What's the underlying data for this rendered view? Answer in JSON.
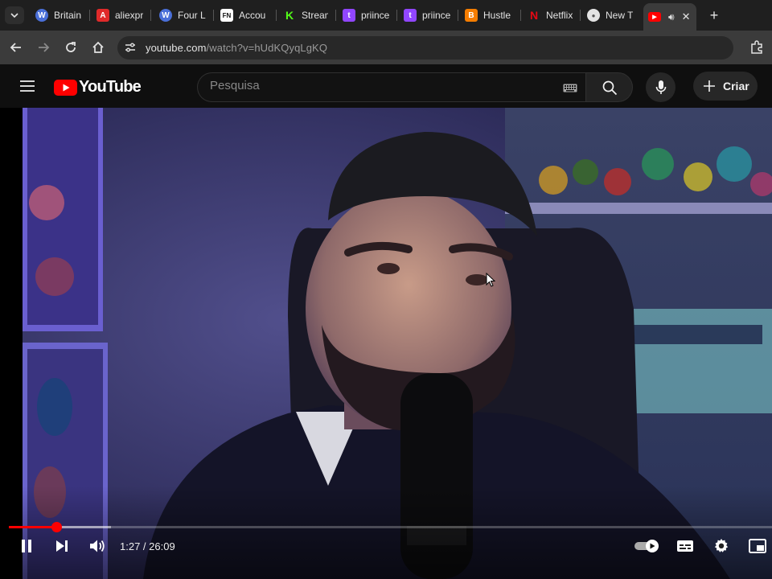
{
  "browser": {
    "tabs": [
      {
        "title": "Britain",
        "favicon": "wikipedia-icon",
        "color": "#4a6fd8"
      },
      {
        "title": "aliexpr",
        "favicon": "aliexpress-icon",
        "color": "#e02a2a"
      },
      {
        "title": "Four L",
        "favicon": "wikipedia-icon",
        "color": "#4a6fd8"
      },
      {
        "title": "Accou",
        "favicon": "fn-icon",
        "color": "#ffffff"
      },
      {
        "title": "Stream",
        "favicon": "kick-icon",
        "color": "#53fc18"
      },
      {
        "title": "priince",
        "favicon": "twitch-icon",
        "color": "#9146ff"
      },
      {
        "title": "priince",
        "favicon": "twitch-icon",
        "color": "#9146ff"
      },
      {
        "title": "Hustle",
        "favicon": "blogger-icon",
        "color": "#f57d00"
      },
      {
        "title": "Netflix",
        "favicon": "netflix-icon",
        "color": "#e50914"
      },
      {
        "title": "New T",
        "favicon": "chrome-icon",
        "color": "#e3e3e3"
      },
      {
        "title": "",
        "favicon": "youtube-icon",
        "color": "#ff0000",
        "active": true
      }
    ],
    "url_host": "youtube.com",
    "url_path": "/watch?v=hUdKQyqLgKQ"
  },
  "youtube": {
    "logo_text": "YouTube",
    "search_placeholder": "Pesquisa",
    "create_label": "Criar"
  },
  "player": {
    "current_time": "1:27",
    "duration": "26:09",
    "time_display": "1:27 / 26:09",
    "played_fraction": 0.0619,
    "loaded_fraction": 0.134,
    "autoplay": true
  }
}
